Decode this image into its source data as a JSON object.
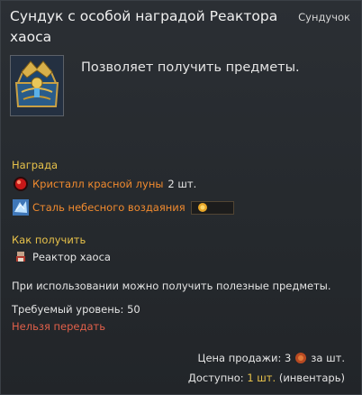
{
  "title": "Сундук с особой наградой Реактора хаоса",
  "item_type": "Сундучок",
  "description": "Позволяет получить предметы.",
  "reward": {
    "heading": "Награда",
    "items": [
      {
        "name": "Кристалл красной луны",
        "qty": "2 шт.",
        "icon": "red-moon-crystal-icon"
      },
      {
        "name": "Сталь небесного воздаяния",
        "qty": "",
        "icon": "heavenly-steel-icon"
      }
    ]
  },
  "obtain": {
    "heading": "Как получить",
    "source": "Реактор хаоса",
    "icon": "dungeon-icon"
  },
  "usage_text": "При использовании можно получить полезные предметы.",
  "required_level": "Требуемый уровень: 50",
  "trade_restriction": "Нельзя передать",
  "sell": {
    "label": "Цена продажи: 3",
    "suffix": "за шт.",
    "icon": "copper-coin-icon"
  },
  "availability": {
    "label": "Доступно:",
    "count": "1 шт.",
    "suffix": "(инвентарь)"
  },
  "colors": {
    "heading": "#e8c24a",
    "rarity": "#f08a2e",
    "warning": "#e0604a"
  }
}
